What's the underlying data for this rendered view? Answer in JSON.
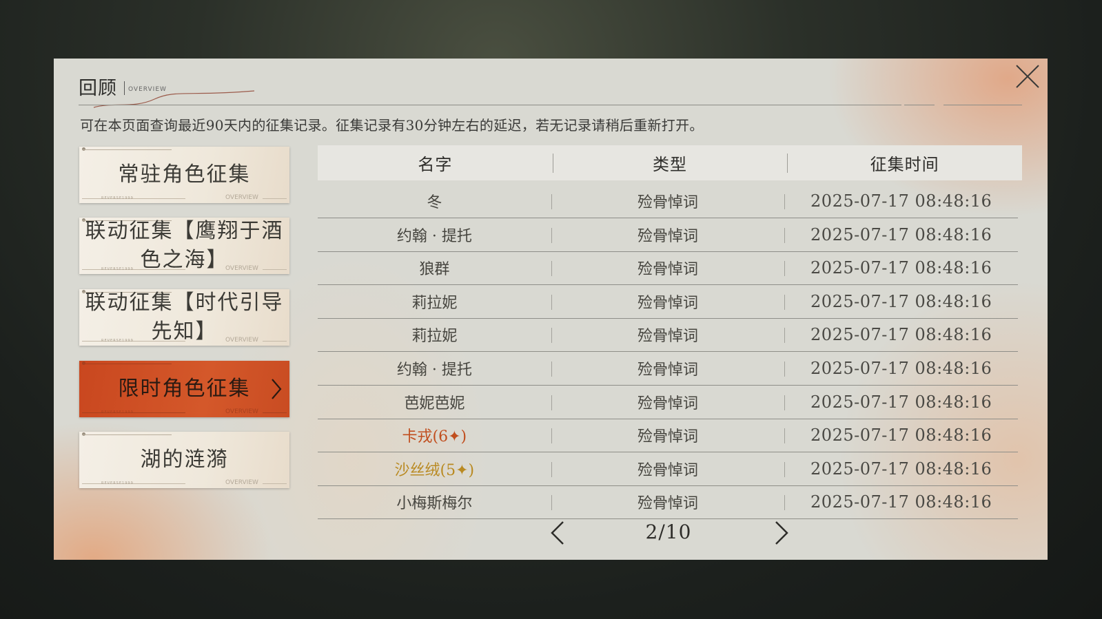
{
  "header": {
    "title": "回顾",
    "subtitle": "OVERVIEW",
    "description": "可在本页面查询最近90天内的征集记录。征集记录有30分钟左右的延迟，若无记录请稍后重新打开。",
    "close_icon": "close-icon"
  },
  "sidebar": {
    "deco_overview": "OVERVIEW",
    "deco_small": "REVERSE1999",
    "items": [
      {
        "label": "常驻角色征集",
        "active": false
      },
      {
        "label": "联动征集【鹰翔于酒色之海】",
        "active": false
      },
      {
        "label": "联动征集【时代引导先知】",
        "active": false
      },
      {
        "label": "限时角色征集",
        "active": true
      },
      {
        "label": "湖的涟漪",
        "active": false
      }
    ]
  },
  "table": {
    "columns": [
      "名字",
      "类型",
      "征集时间"
    ],
    "rows": [
      {
        "name": "冬",
        "type": "殓骨悼词",
        "time": "2025-07-17 08:48:16",
        "rarity": "normal"
      },
      {
        "name": "约翰 · 提托",
        "type": "殓骨悼词",
        "time": "2025-07-17 08:48:16",
        "rarity": "normal"
      },
      {
        "name": "狼群",
        "type": "殓骨悼词",
        "time": "2025-07-17 08:48:16",
        "rarity": "normal"
      },
      {
        "name": "莉拉妮",
        "type": "殓骨悼词",
        "time": "2025-07-17 08:48:16",
        "rarity": "normal"
      },
      {
        "name": "莉拉妮",
        "type": "殓骨悼词",
        "time": "2025-07-17 08:48:16",
        "rarity": "normal"
      },
      {
        "name": "约翰 · 提托",
        "type": "殓骨悼词",
        "time": "2025-07-17 08:48:16",
        "rarity": "normal"
      },
      {
        "name": "芭妮芭妮",
        "type": "殓骨悼词",
        "time": "2025-07-17 08:48:16",
        "rarity": "normal"
      },
      {
        "name": "卡戎(6✦)",
        "type": "殓骨悼词",
        "time": "2025-07-17 08:48:16",
        "rarity": "6"
      },
      {
        "name": "沙丝绒(5✦)",
        "type": "殓骨悼词",
        "time": "2025-07-17 08:48:16",
        "rarity": "5"
      },
      {
        "name": "小梅斯梅尔",
        "type": "殓骨悼词",
        "time": "2025-07-17 08:48:16",
        "rarity": "normal"
      }
    ]
  },
  "pagination": {
    "text": "2/10",
    "prev_icon": "chevron-left-icon",
    "next_icon": "chevron-right-icon"
  },
  "colors": {
    "accent": "#d0522a",
    "rarity_6": "#c14e1e",
    "rarity_5": "#b98a22",
    "panel": "#d9d9d2"
  }
}
